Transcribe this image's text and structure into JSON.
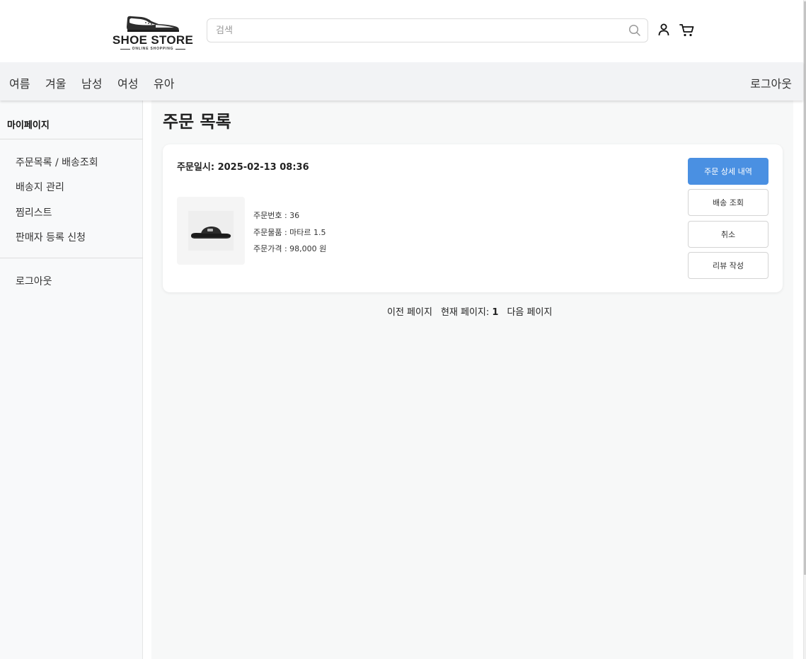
{
  "header": {
    "logo_text": "SHOE STORE",
    "logo_subtext": "ONLINE SHOPPING",
    "search": {
      "placeholder": "검색",
      "value": ""
    },
    "icons": [
      "search-icon",
      "user-icon",
      "cart-icon"
    ]
  },
  "nav": {
    "items": [
      {
        "label": "여름"
      },
      {
        "label": "겨울"
      },
      {
        "label": "남성"
      },
      {
        "label": "여성"
      },
      {
        "label": "유아"
      }
    ],
    "logout_label": "로그아웃"
  },
  "sidebar": {
    "title": "마이페이지",
    "items": [
      {
        "label": "주문목록 / 배송조회"
      },
      {
        "label": "배송지 관리"
      },
      {
        "label": "찜리스트"
      },
      {
        "label": "판매자 등록 신청"
      }
    ],
    "logout_label": "로그아웃"
  },
  "main": {
    "title": "주문 목록",
    "orders": [
      {
        "date_label": "주문일시: 2025-02-13 08:36",
        "order_number": "주문번호 : 36",
        "product": "주문물품 : 마타르 1.5",
        "price": "주문가격 : 98,000 원",
        "buttons": {
          "detail": "주문 상세 내역",
          "tracking": "배송 조회",
          "cancel": "취소",
          "review": "리뷰 작성"
        }
      }
    ],
    "pagination": {
      "prev": "이전 페이지",
      "current_label": "현재 페이지:",
      "current_page": "1",
      "next": "다음 페이지"
    }
  },
  "colors": {
    "primary": "#4a90e2",
    "nav_bg": "#f2f3f5",
    "sidebar_bg": "#f8f9fa",
    "main_bg": "#f7f8f8"
  }
}
